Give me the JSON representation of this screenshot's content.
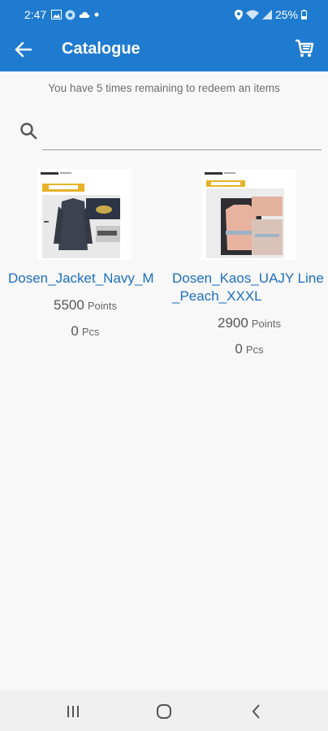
{
  "status": {
    "time": "2:47",
    "battery": "25%",
    "icons_left": [
      "image-icon",
      "circle-icon",
      "cloud-icon",
      "dot-icon"
    ],
    "icons_right": [
      "location-icon",
      "wifi-icon",
      "signal-icon",
      "battery-icon"
    ]
  },
  "appbar": {
    "title": "Catalogue"
  },
  "subtitle": "You have 5 times remaining to redeem an items",
  "search": {
    "value": "",
    "placeholder": ""
  },
  "products": [
    {
      "name": "Dosen_Jacket_Navy_M",
      "points": "5500",
      "points_unit": "Points",
      "qty": "0",
      "qty_unit": "Pcs"
    },
    {
      "name": "Dosen_Kaos_UAJY Line_Peach_XXXL",
      "points": "2900",
      "points_unit": "Points",
      "qty": "0",
      "qty_unit": "Pcs"
    }
  ],
  "colors": {
    "primary": "#1f7bd0",
    "link": "#1c6fbf",
    "background": "#f8f8f8"
  }
}
